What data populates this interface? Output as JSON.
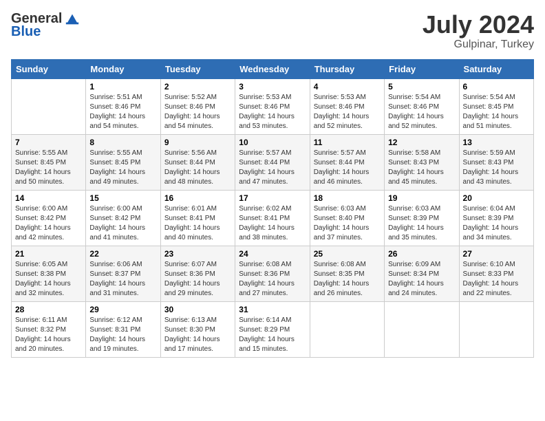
{
  "header": {
    "logo_general": "General",
    "logo_blue": "Blue",
    "month_year": "July 2024",
    "location": "Gulpinar, Turkey"
  },
  "weekdays": [
    "Sunday",
    "Monday",
    "Tuesday",
    "Wednesday",
    "Thursday",
    "Friday",
    "Saturday"
  ],
  "weeks": [
    [
      {
        "day": "",
        "sunrise": "",
        "sunset": "",
        "daylight": ""
      },
      {
        "day": "1",
        "sunrise": "5:51 AM",
        "sunset": "8:46 PM",
        "daylight": "14 hours and 54 minutes."
      },
      {
        "day": "2",
        "sunrise": "5:52 AM",
        "sunset": "8:46 PM",
        "daylight": "14 hours and 54 minutes."
      },
      {
        "day": "3",
        "sunrise": "5:53 AM",
        "sunset": "8:46 PM",
        "daylight": "14 hours and 53 minutes."
      },
      {
        "day": "4",
        "sunrise": "5:53 AM",
        "sunset": "8:46 PM",
        "daylight": "14 hours and 52 minutes."
      },
      {
        "day": "5",
        "sunrise": "5:54 AM",
        "sunset": "8:46 PM",
        "daylight": "14 hours and 52 minutes."
      },
      {
        "day": "6",
        "sunrise": "5:54 AM",
        "sunset": "8:45 PM",
        "daylight": "14 hours and 51 minutes."
      }
    ],
    [
      {
        "day": "7",
        "sunrise": "5:55 AM",
        "sunset": "8:45 PM",
        "daylight": "14 hours and 50 minutes."
      },
      {
        "day": "8",
        "sunrise": "5:55 AM",
        "sunset": "8:45 PM",
        "daylight": "14 hours and 49 minutes."
      },
      {
        "day": "9",
        "sunrise": "5:56 AM",
        "sunset": "8:44 PM",
        "daylight": "14 hours and 48 minutes."
      },
      {
        "day": "10",
        "sunrise": "5:57 AM",
        "sunset": "8:44 PM",
        "daylight": "14 hours and 47 minutes."
      },
      {
        "day": "11",
        "sunrise": "5:57 AM",
        "sunset": "8:44 PM",
        "daylight": "14 hours and 46 minutes."
      },
      {
        "day": "12",
        "sunrise": "5:58 AM",
        "sunset": "8:43 PM",
        "daylight": "14 hours and 45 minutes."
      },
      {
        "day": "13",
        "sunrise": "5:59 AM",
        "sunset": "8:43 PM",
        "daylight": "14 hours and 43 minutes."
      }
    ],
    [
      {
        "day": "14",
        "sunrise": "6:00 AM",
        "sunset": "8:42 PM",
        "daylight": "14 hours and 42 minutes."
      },
      {
        "day": "15",
        "sunrise": "6:00 AM",
        "sunset": "8:42 PM",
        "daylight": "14 hours and 41 minutes."
      },
      {
        "day": "16",
        "sunrise": "6:01 AM",
        "sunset": "8:41 PM",
        "daylight": "14 hours and 40 minutes."
      },
      {
        "day": "17",
        "sunrise": "6:02 AM",
        "sunset": "8:41 PM",
        "daylight": "14 hours and 38 minutes."
      },
      {
        "day": "18",
        "sunrise": "6:03 AM",
        "sunset": "8:40 PM",
        "daylight": "14 hours and 37 minutes."
      },
      {
        "day": "19",
        "sunrise": "6:03 AM",
        "sunset": "8:39 PM",
        "daylight": "14 hours and 35 minutes."
      },
      {
        "day": "20",
        "sunrise": "6:04 AM",
        "sunset": "8:39 PM",
        "daylight": "14 hours and 34 minutes."
      }
    ],
    [
      {
        "day": "21",
        "sunrise": "6:05 AM",
        "sunset": "8:38 PM",
        "daylight": "14 hours and 32 minutes."
      },
      {
        "day": "22",
        "sunrise": "6:06 AM",
        "sunset": "8:37 PM",
        "daylight": "14 hours and 31 minutes."
      },
      {
        "day": "23",
        "sunrise": "6:07 AM",
        "sunset": "8:36 PM",
        "daylight": "14 hours and 29 minutes."
      },
      {
        "day": "24",
        "sunrise": "6:08 AM",
        "sunset": "8:36 PM",
        "daylight": "14 hours and 27 minutes."
      },
      {
        "day": "25",
        "sunrise": "6:08 AM",
        "sunset": "8:35 PM",
        "daylight": "14 hours and 26 minutes."
      },
      {
        "day": "26",
        "sunrise": "6:09 AM",
        "sunset": "8:34 PM",
        "daylight": "14 hours and 24 minutes."
      },
      {
        "day": "27",
        "sunrise": "6:10 AM",
        "sunset": "8:33 PM",
        "daylight": "14 hours and 22 minutes."
      }
    ],
    [
      {
        "day": "28",
        "sunrise": "6:11 AM",
        "sunset": "8:32 PM",
        "daylight": "14 hours and 20 minutes."
      },
      {
        "day": "29",
        "sunrise": "6:12 AM",
        "sunset": "8:31 PM",
        "daylight": "14 hours and 19 minutes."
      },
      {
        "day": "30",
        "sunrise": "6:13 AM",
        "sunset": "8:30 PM",
        "daylight": "14 hours and 17 minutes."
      },
      {
        "day": "31",
        "sunrise": "6:14 AM",
        "sunset": "8:29 PM",
        "daylight": "14 hours and 15 minutes."
      },
      {
        "day": "",
        "sunrise": "",
        "sunset": "",
        "daylight": ""
      },
      {
        "day": "",
        "sunrise": "",
        "sunset": "",
        "daylight": ""
      },
      {
        "day": "",
        "sunrise": "",
        "sunset": "",
        "daylight": ""
      }
    ]
  ]
}
